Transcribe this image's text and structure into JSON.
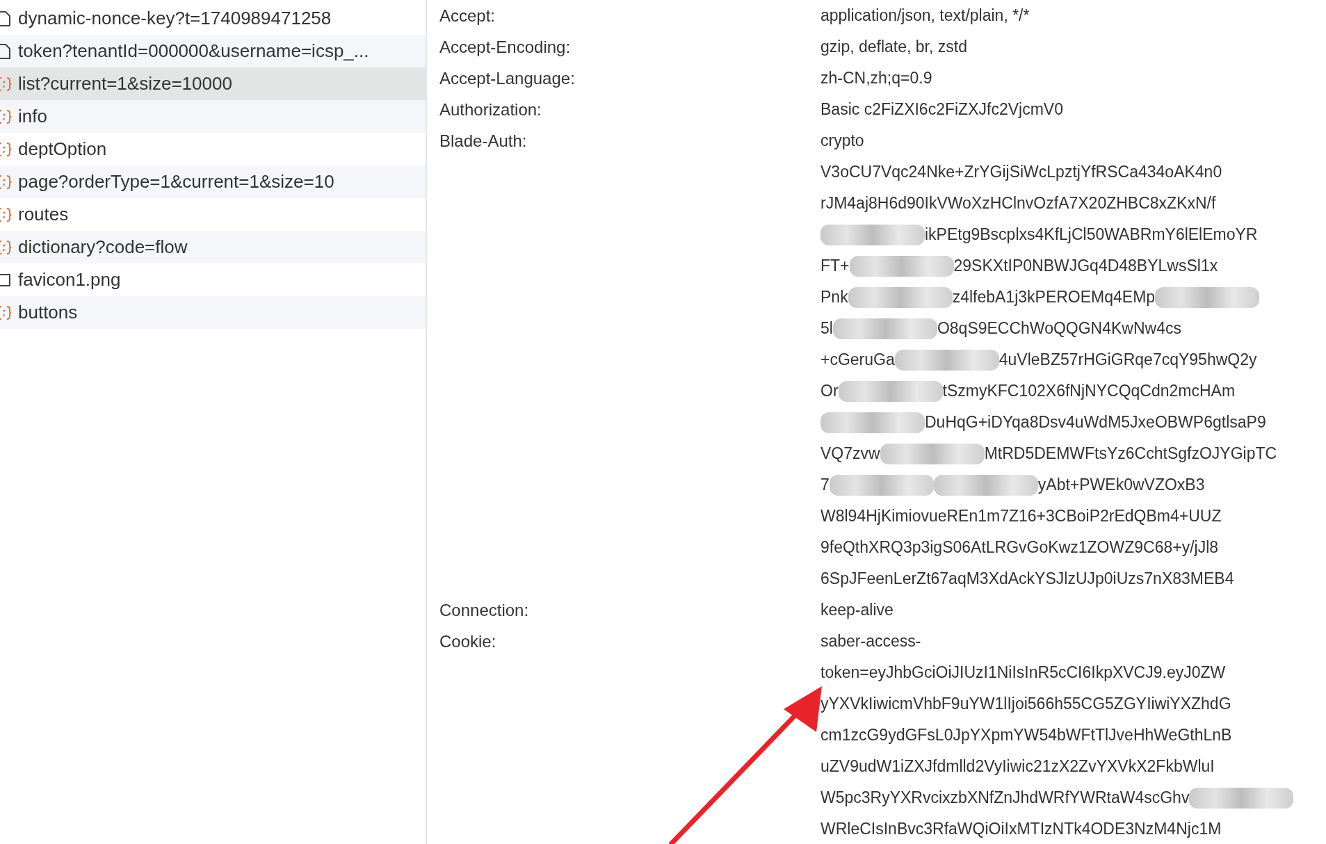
{
  "requests": [
    {
      "name": "dynamic-nonce-key?t=1740989471258",
      "kind": "doc",
      "selected": false
    },
    {
      "name": "token?tenantId=000000&username=icsp_...",
      "kind": "doc",
      "selected": false
    },
    {
      "name": "list?current=1&size=10000",
      "kind": "json",
      "selected": true
    },
    {
      "name": "info",
      "kind": "json",
      "selected": false
    },
    {
      "name": "deptOption",
      "kind": "json",
      "selected": false
    },
    {
      "name": "page?orderType=1&current=1&size=10",
      "kind": "json",
      "selected": false
    },
    {
      "name": "routes",
      "kind": "json",
      "selected": false
    },
    {
      "name": "dictionary?code=flow",
      "kind": "json",
      "selected": false
    },
    {
      "name": "favicon1.png",
      "kind": "image",
      "selected": false
    },
    {
      "name": "buttons",
      "kind": "json",
      "selected": false
    }
  ],
  "headers": [
    {
      "name": "Accept:",
      "lines": [
        [
          {
            "kind": "text",
            "text": "application/json, text/plain, */*"
          }
        ]
      ]
    },
    {
      "name": "Accept-Encoding:",
      "lines": [
        [
          {
            "kind": "text",
            "text": "gzip, deflate, br, zstd"
          }
        ]
      ]
    },
    {
      "name": "Accept-Language:",
      "lines": [
        [
          {
            "kind": "text",
            "text": "zh-CN,zh;q=0.9"
          }
        ]
      ]
    },
    {
      "name": "Authorization:",
      "lines": [
        [
          {
            "kind": "text",
            "text": "Basic c2FiZXI6c2FiZXJfc2VjcmV0"
          }
        ]
      ]
    },
    {
      "name": "Blade-Auth:",
      "lines": [
        [
          {
            "kind": "text",
            "text": "crypto"
          }
        ],
        [
          {
            "kind": "text",
            "text": "V3oCU7Vqc24Nke+ZrYGijSiWcLpztjYfRSCa434oAK4n0"
          }
        ],
        [
          {
            "kind": "text",
            "text": "rJM4aj8H6d90IkVWoXzHClnvOzfA7X20ZHBC8xZKxN/f"
          }
        ],
        [
          {
            "kind": "blur"
          },
          {
            "kind": "text",
            "text": "ikPEtg9Bscplxs4KfLjCl50WABRmY6lElEmoYR"
          }
        ],
        [
          {
            "kind": "text",
            "text": "FT+"
          },
          {
            "kind": "blur"
          },
          {
            "kind": "text",
            "text": "29SKXtIP0NBWJGq4D48BYLwsSl1x"
          }
        ],
        [
          {
            "kind": "text",
            "text": "Pnk"
          },
          {
            "kind": "blur"
          },
          {
            "kind": "text",
            "text": "z4lfebA1j3kPEROEMq4EMp"
          },
          {
            "kind": "blur"
          }
        ],
        [
          {
            "kind": "text",
            "text": "5l"
          },
          {
            "kind": "blur"
          },
          {
            "kind": "text",
            "text": "O8qS9ECChWoQQGN4KwNw4cs"
          }
        ],
        [
          {
            "kind": "text",
            "text": "+cGeruGa"
          },
          {
            "kind": "blur"
          },
          {
            "kind": "text",
            "text": "4uVleBZ57rHGiGRqe7cqY95hwQ2y"
          }
        ],
        [
          {
            "kind": "text",
            "text": "Or"
          },
          {
            "kind": "blur"
          },
          {
            "kind": "text",
            "text": "tSzmyKFC102X6fNjNYCQqCdn2mcHAm"
          }
        ],
        [
          {
            "kind": "blur"
          },
          {
            "kind": "text",
            "text": "DuHqG+iDYqa8Dsv4uWdM5JxeOBWP6gtlsaP9"
          }
        ],
        [
          {
            "kind": "text",
            "text": "VQ7zvw"
          },
          {
            "kind": "blur"
          },
          {
            "kind": "text",
            "text": "MtRD5DEMWFtsYz6CchtSgfzOJYGipTC"
          }
        ],
        [
          {
            "kind": "text",
            "text": "7"
          },
          {
            "kind": "blur"
          },
          {
            "kind": "blur"
          },
          {
            "kind": "text",
            "text": "yAbt+PWEk0wVZOxB3"
          }
        ],
        [
          {
            "kind": "text",
            "text": "W8l94HjKimiovueREn1m7Z16+3CBoiP2rEdQBm4+UUZ"
          }
        ],
        [
          {
            "kind": "text",
            "text": "9feQthXRQ3p3igS06AtLRGvGoKwz1ZOWZ9C68+y/jJl8"
          }
        ],
        [
          {
            "kind": "text",
            "text": "6SpJFeenLerZt67aqM3XdAckYSJlzUJp0iUzs7nX83MEB4"
          }
        ]
      ]
    },
    {
      "name": "Connection:",
      "lines": [
        [
          {
            "kind": "text",
            "text": "keep-alive"
          }
        ]
      ]
    },
    {
      "name": "Cookie:",
      "lines": [
        [
          {
            "kind": "text",
            "text": "saber-access-"
          }
        ],
        [
          {
            "kind": "text",
            "text": "token=eyJhbGciOiJIUzI1NiIsInR5cCI6IkpXVCJ9.eyJ0ZW"
          }
        ],
        [
          {
            "kind": "text",
            "text": "yYXVkIiwicmVhbF9uYW1lIjoi566h55CG5ZGYIiwiYXZhdG"
          }
        ],
        [
          {
            "kind": "text",
            "text": "cm1zcG9ydGFsL0JpYXpmYW54bWFtTlJveHhWeGthLnB"
          }
        ],
        [
          {
            "kind": "text",
            "text": "uZV9udW1iZXJfdmlld2VyIiwic21zX2ZvYXVkX2FkbWluI"
          }
        ],
        [
          {
            "kind": "text",
            "text": "W5pc3RyYXRvcixzbXNfZnJhdWRfYWRtaW4scGhv"
          },
          {
            "kind": "blur"
          }
        ],
        [
          {
            "kind": "text",
            "text": "WRleCIsInBvc3RfaWQiOiIxMTIzNTk4ODE3NzM4Njc1M"
          }
        ]
      ]
    }
  ]
}
